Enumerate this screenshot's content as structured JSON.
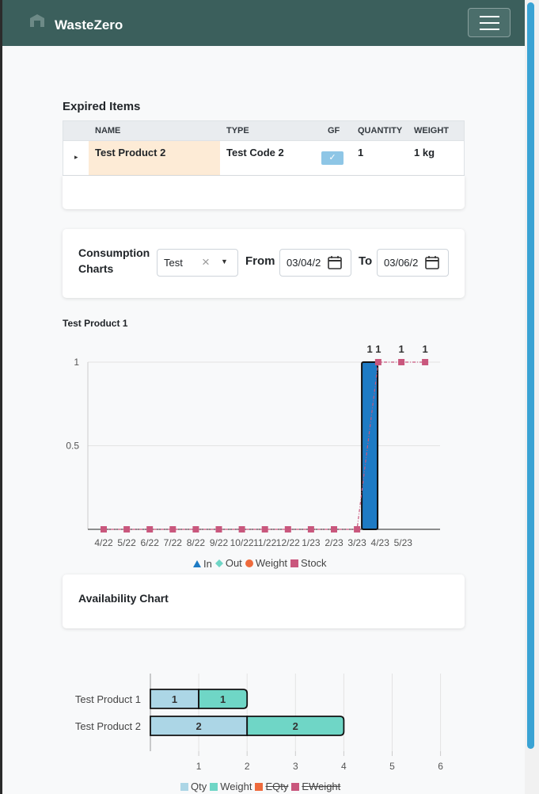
{
  "app": {
    "brand": "WasteZero"
  },
  "expired": {
    "title": "Expired Items",
    "columns": [
      "NAME",
      "TYPE",
      "GF",
      "QUANTITY",
      "WEIGHT"
    ],
    "rows": [
      {
        "name": "Test Product 2",
        "type": "Test Code 2",
        "gf": true,
        "quantity": "1",
        "weight": "1 kg"
      }
    ]
  },
  "consumption": {
    "title_line1": "Consumption",
    "title_line2": "Charts",
    "select_value": "Test",
    "from_label": "From",
    "from_value": "03/04/2",
    "to_label": "To",
    "to_value": "03/06/2"
  },
  "chart_data": [
    {
      "type": "bar",
      "title": "Test Product 1",
      "categories": [
        "4/22",
        "5/22",
        "6/22",
        "7/22",
        "8/22",
        "9/22",
        "10/22",
        "11/22",
        "12/22",
        "1/23",
        "2/23",
        "3/23",
        "4/23",
        "5/23"
      ],
      "y_ticks": [
        "1",
        "0.5"
      ],
      "ylim": [
        0,
        1
      ],
      "grid": true,
      "legend_position": "bottom",
      "legend": [
        "In",
        "Out",
        "Weight",
        "Stock"
      ],
      "series": [
        {
          "name": "In",
          "kind": "bar",
          "color": "#1e7bc4",
          "x": "3/23",
          "value": 1
        },
        {
          "name": "Stock",
          "kind": "line",
          "color": "#c9577d",
          "points": [
            [
              "4/22",
              0
            ],
            [
              "5/22",
              0
            ],
            [
              "6/22",
              0
            ],
            [
              "7/22",
              0
            ],
            [
              "8/22",
              0
            ],
            [
              "9/22",
              0
            ],
            [
              "10/22",
              0
            ],
            [
              "11/22",
              0
            ],
            [
              "12/22",
              0
            ],
            [
              "1/23",
              0
            ],
            [
              "2/23",
              0
            ],
            [
              "3/23",
              0
            ],
            [
              "3/23+",
              1
            ],
            [
              "4/23",
              1
            ],
            [
              "5/23",
              1
            ]
          ]
        }
      ],
      "data_labels": [
        "1",
        "1",
        "1",
        "1"
      ]
    },
    {
      "type": "bar",
      "orientation": "horizontal",
      "stacked": true,
      "categories": [
        "Test Product 1",
        "Test Product 2"
      ],
      "x_ticks": [
        "1",
        "2",
        "3",
        "4",
        "5",
        "6"
      ],
      "xlim": [
        0,
        6
      ],
      "grid": true,
      "legend_position": "bottom",
      "legend": [
        "Qty",
        "Weight",
        "EQty",
        "EWeight"
      ],
      "series": [
        {
          "name": "Qty",
          "color": "#acd6e6",
          "values": [
            1,
            2
          ]
        },
        {
          "name": "Weight",
          "color": "#6fd6c6",
          "values": [
            1,
            2
          ]
        },
        {
          "name": "EQty",
          "color": "#ee6a3c",
          "values": [
            0,
            0
          ]
        },
        {
          "name": "EWeight",
          "color": "#c9577d",
          "values": [
            0,
            0
          ]
        }
      ]
    }
  ],
  "availability": {
    "title": "Availability Chart"
  },
  "colors": {
    "navbar": "#3b5f5c",
    "accent": "#3aa3d4",
    "highlight": "#fdebd6"
  }
}
